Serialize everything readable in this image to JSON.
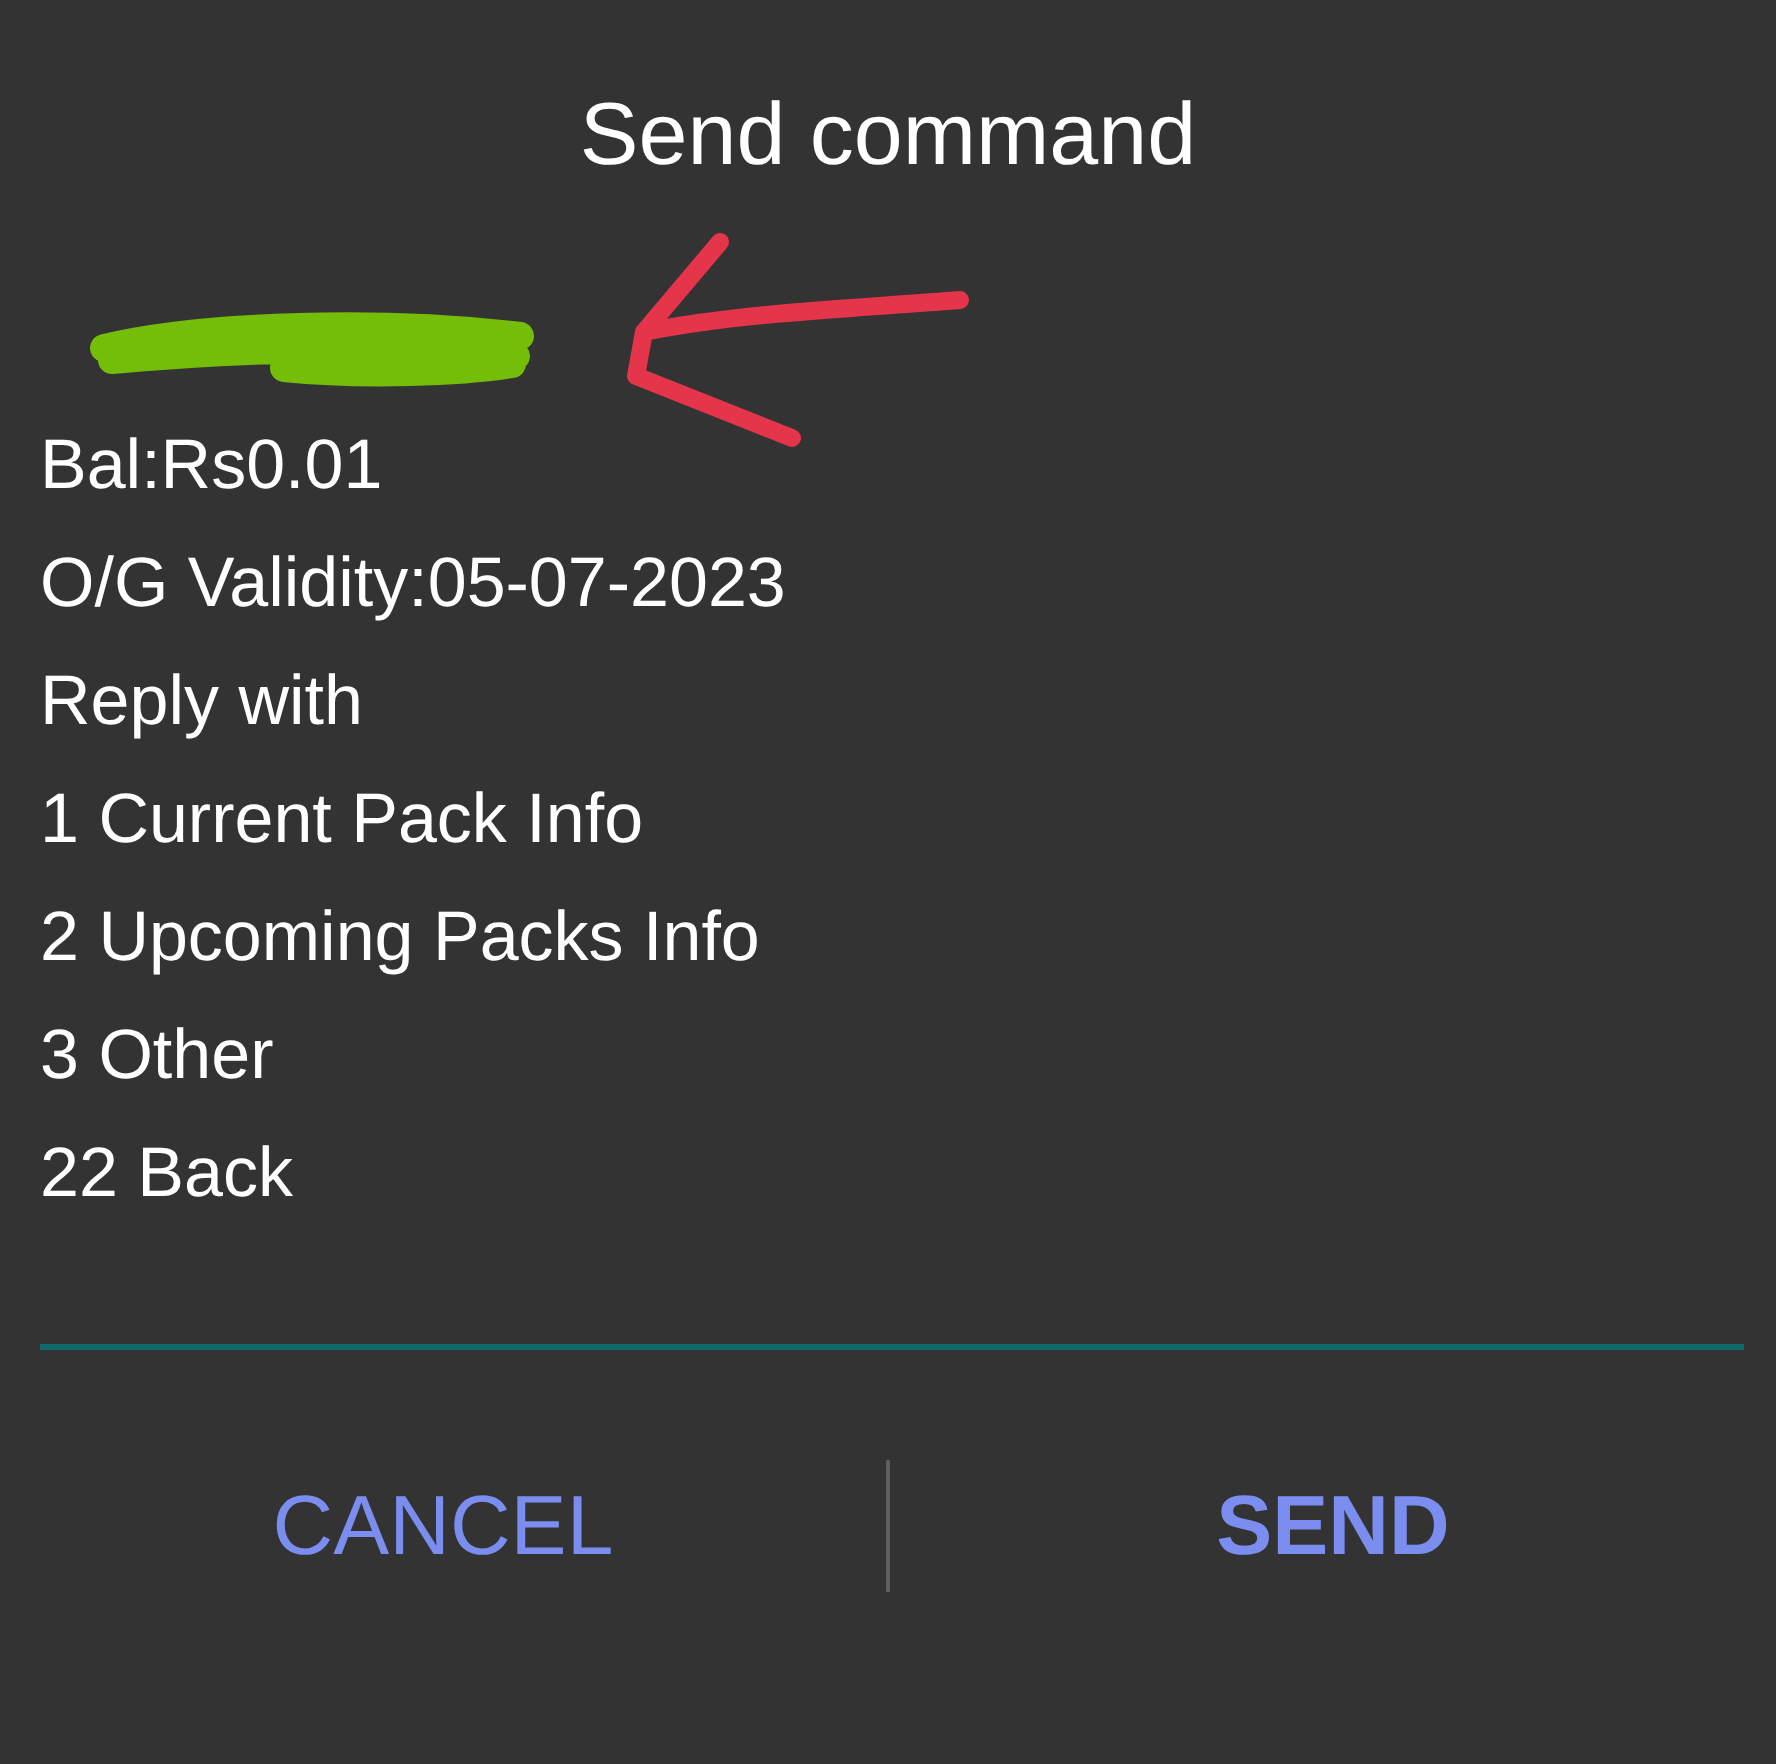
{
  "dialog": {
    "title": "Send command"
  },
  "message_lines": [
    {
      "kind": "redacted",
      "arrow_marked": true
    },
    {
      "kind": "text",
      "text": "Bal:Rs0.01"
    },
    {
      "kind": "text",
      "text": "O/G Validity:05-07-2023"
    },
    {
      "kind": "text",
      "text": "Reply with"
    },
    {
      "kind": "text",
      "text": "1 Current Pack Info"
    },
    {
      "kind": "text",
      "text": "2 Upcoming Packs Info"
    },
    {
      "kind": "text",
      "text": "3 Other"
    },
    {
      "kind": "text",
      "text": "22 Back"
    }
  ],
  "buttons": [
    {
      "label": "CANCEL",
      "kind": "cancel"
    },
    {
      "label": "SEND",
      "kind": "confirm"
    }
  ]
}
